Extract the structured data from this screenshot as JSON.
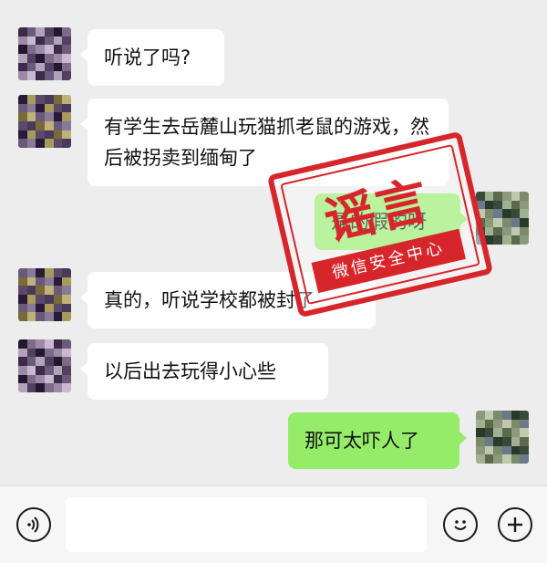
{
  "messages": [
    {
      "side": "left",
      "text": "听说了吗?"
    },
    {
      "side": "left",
      "text": "有学生去岳麓山玩猫抓老鼠的游戏，然后被拐卖到缅甸了"
    },
    {
      "side": "right",
      "text": "是的假的呀"
    },
    {
      "side": "left",
      "text": "真的，听说学校都被封了"
    },
    {
      "side": "left",
      "text": "以后出去玩得小心些"
    },
    {
      "side": "right",
      "text": "那可太吓人了"
    }
  ],
  "stamp": {
    "title": "谣言",
    "org": "微信安全中心",
    "color": "#d7262b"
  },
  "input_bar": {
    "voice_icon": "voice-icon",
    "emoji_icon": "emoji-icon",
    "plus_icon": "plus-icon",
    "input_value": ""
  },
  "colors": {
    "background": "#ededed",
    "right_bubble": "#95ec69",
    "left_bubble": "#ffffff"
  }
}
